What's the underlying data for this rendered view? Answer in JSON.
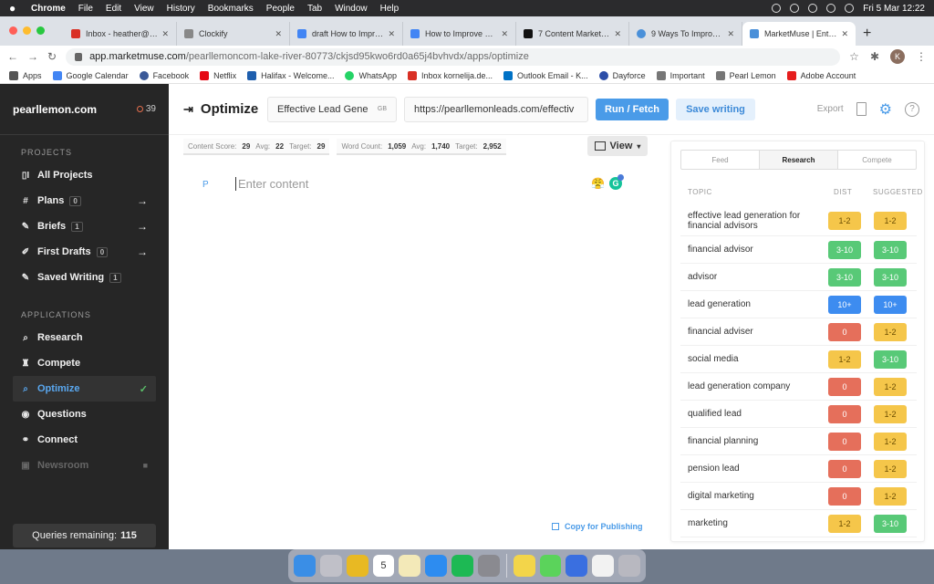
{
  "menubar": {
    "menus": [
      "Chrome",
      "File",
      "Edit",
      "View",
      "History",
      "Bookmarks",
      "People",
      "Tab",
      "Window",
      "Help"
    ],
    "datetime": "Fri 5 Mar  12:22"
  },
  "tabs": [
    {
      "title": "Inbox - heather@pla",
      "color": "#d93025"
    },
    {
      "title": "Clockify",
      "color": "#888888"
    },
    {
      "title": "draft How to Improve",
      "color": "#4285f4"
    },
    {
      "title": "How to Improve Con",
      "color": "#4285f4"
    },
    {
      "title": "7 Content Marketing",
      "color": "#111111"
    },
    {
      "title": "9 Ways To Improve Y",
      "color": "#4a90d9"
    },
    {
      "title": "MarketMuse | Enterp",
      "color": "#4a90d9"
    }
  ],
  "address": {
    "host": "app.marketmuse.com",
    "path": "/pearllemoncom-lake-river-80773/ckjsd95kwo6rd0a65j4bvhvdx/apps/optimize",
    "profile_initial": "K"
  },
  "bookmarks": [
    {
      "label": "Apps",
      "color": "#555555"
    },
    {
      "label": "Google Calendar",
      "color": "#4285f4"
    },
    {
      "label": "Facebook",
      "color": "#3b5998"
    },
    {
      "label": "Netflix",
      "color": "#e50914"
    },
    {
      "label": "Halifax - Welcome...",
      "color": "#1f5fae"
    },
    {
      "label": "WhatsApp",
      "color": "#25d366"
    },
    {
      "label": "Inbox kornelija.de...",
      "color": "#d93025"
    },
    {
      "label": "Outlook Email - K...",
      "color": "#0072c6"
    },
    {
      "label": "Dayforce",
      "color": "#2c4ea8"
    },
    {
      "label": "Important",
      "color": "#777777"
    },
    {
      "label": "Pearl Lemon",
      "color": "#777777"
    },
    {
      "label": "Adobe Account",
      "color": "#e61e1e"
    }
  ],
  "sidebar": {
    "brand": "pearllemon.com",
    "count": "39",
    "projects_heading": "PROJECTS",
    "projects": [
      {
        "label": "All Projects",
        "icon": "▯I",
        "badge": "",
        "arrow": ""
      },
      {
        "label": "Plans",
        "icon": "#",
        "badge": "0",
        "arrow": "→"
      },
      {
        "label": "Briefs",
        "icon": "✎",
        "badge": "1",
        "arrow": "→"
      },
      {
        "label": "First Drafts",
        "icon": "✐",
        "badge": "0",
        "arrow": "→"
      },
      {
        "label": "Saved Writing",
        "icon": "✎",
        "badge": "1",
        "arrow": ""
      }
    ],
    "apps_heading": "APPLICATIONS",
    "apps": [
      {
        "label": "Research",
        "icon": "⌕"
      },
      {
        "label": "Compete",
        "icon": "♜"
      },
      {
        "label": "Optimize",
        "icon": "⌕"
      },
      {
        "label": "Questions",
        "icon": "◉"
      },
      {
        "label": "Connect",
        "icon": "⚭"
      },
      {
        "label": "Newsroom",
        "icon": "▣"
      }
    ],
    "queries_label": "Queries remaining:",
    "queries_value": "115"
  },
  "toolbar": {
    "title": "Optimize",
    "topic": "Effective Lead Gene",
    "topic_flag": "GB",
    "url": "https://pearllemonleads.com/effectiv",
    "run_label": "Run / Fetch",
    "save_label": "Save writing",
    "export_label": "Export"
  },
  "scores": {
    "content_label": "Content Score:",
    "content_value": "29",
    "avg_label": "Avg:",
    "content_avg": "22",
    "target_label": "Target:",
    "content_target": "29",
    "wc_label": "Word Count:",
    "wc_value": "1,059",
    "wc_avg": "1,740",
    "wc_target": "2,952"
  },
  "editor": {
    "para_marker": "P",
    "placeholder": "Enter content",
    "view_label": "View",
    "copy_label": "Copy for Publishing",
    "grammarly_letter": "G"
  },
  "panel": {
    "tabs": [
      "Feed",
      "Research",
      "Compete"
    ],
    "active_tab": "Research",
    "headers": {
      "topic": "TOPIC",
      "dist": "DIST",
      "suggested": "SUGGESTED"
    },
    "rows": [
      {
        "topic": "effective lead generation for financial advisors",
        "dist": "1-2",
        "dist_color": "yellow",
        "sug": "1-2",
        "sug_color": "yellow"
      },
      {
        "topic": "financial advisor",
        "dist": "3-10",
        "dist_color": "green",
        "sug": "3-10",
        "sug_color": "green"
      },
      {
        "topic": "advisor",
        "dist": "3-10",
        "dist_color": "green",
        "sug": "3-10",
        "sug_color": "green"
      },
      {
        "topic": "lead generation",
        "dist": "10+",
        "dist_color": "blue",
        "sug": "10+",
        "sug_color": "blue"
      },
      {
        "topic": "financial adviser",
        "dist": "0",
        "dist_color": "red",
        "sug": "1-2",
        "sug_color": "yellow"
      },
      {
        "topic": "social media",
        "dist": "1-2",
        "dist_color": "yellow",
        "sug": "3-10",
        "sug_color": "green"
      },
      {
        "topic": "lead generation company",
        "dist": "0",
        "dist_color": "red",
        "sug": "1-2",
        "sug_color": "yellow"
      },
      {
        "topic": "qualified lead",
        "dist": "0",
        "dist_color": "red",
        "sug": "1-2",
        "sug_color": "yellow"
      },
      {
        "topic": "financial planning",
        "dist": "0",
        "dist_color": "red",
        "sug": "1-2",
        "sug_color": "yellow"
      },
      {
        "topic": "pension lead",
        "dist": "0",
        "dist_color": "red",
        "sug": "1-2",
        "sug_color": "yellow"
      },
      {
        "topic": "digital marketing",
        "dist": "0",
        "dist_color": "red",
        "sug": "1-2",
        "sug_color": "yellow"
      },
      {
        "topic": "marketing",
        "dist": "1-2",
        "dist_color": "yellow",
        "sug": "3-10",
        "sug_color": "green"
      }
    ]
  },
  "dock": [
    {
      "name": "finder",
      "color": "#3a8ee6"
    },
    {
      "name": "launchpad",
      "color": "#c0c0c8"
    },
    {
      "name": "chrome",
      "color": "#e8b923"
    },
    {
      "name": "calendar",
      "color": "#ffffff",
      "label": "5"
    },
    {
      "name": "notes",
      "color": "#f3e9b8"
    },
    {
      "name": "app-store",
      "color": "#2d8cf0"
    },
    {
      "name": "spotify",
      "color": "#1db954"
    },
    {
      "name": "system-preferences",
      "color": "#8a8a90"
    },
    {
      "name": "stickies",
      "color": "#f3d54a"
    },
    {
      "name": "messages",
      "color": "#5bd35b"
    },
    {
      "name": "topnotch",
      "color": "#3a6fe0"
    },
    {
      "name": "document",
      "color": "#f2f2f2"
    },
    {
      "name": "trash",
      "color": "#b8b8c0"
    }
  ]
}
